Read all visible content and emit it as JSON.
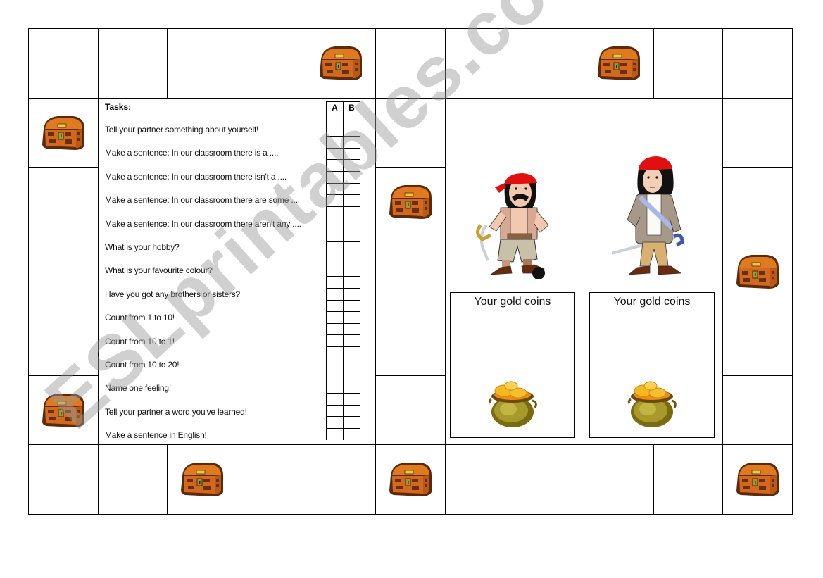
{
  "board": {
    "colors": {
      "chest_body": "#d2691e",
      "chest_lid": "#e07a1f",
      "chest_dark": "#5a2a0a",
      "lock": "#9a9a3a",
      "pot": "#8a8a1e",
      "coin": "#f5b820",
      "bandana": "#e01010"
    },
    "squares": [
      {
        "id": "top-1",
        "chest": false
      },
      {
        "id": "top-2",
        "chest": false
      },
      {
        "id": "top-3",
        "chest": false
      },
      {
        "id": "top-4",
        "chest": false
      },
      {
        "id": "top-5",
        "chest": true
      },
      {
        "id": "top-6",
        "chest": false
      },
      {
        "id": "top-7",
        "chest": false
      },
      {
        "id": "top-8",
        "chest": false
      },
      {
        "id": "top-9",
        "chest": true
      },
      {
        "id": "top-10",
        "chest": false
      },
      {
        "id": "top-11",
        "chest": false
      },
      {
        "id": "left-2",
        "chest": true
      },
      {
        "id": "left-3",
        "chest": false
      },
      {
        "id": "left-4",
        "chest": false
      },
      {
        "id": "left-5",
        "chest": false
      },
      {
        "id": "left-6",
        "chest": true
      },
      {
        "id": "mid-2",
        "chest": false
      },
      {
        "id": "mid-3",
        "chest": true
      },
      {
        "id": "mid-4",
        "chest": false
      },
      {
        "id": "mid-5",
        "chest": false
      },
      {
        "id": "mid-6",
        "chest": false
      },
      {
        "id": "right-2",
        "chest": false
      },
      {
        "id": "right-3",
        "chest": false
      },
      {
        "id": "right-4",
        "chest": true
      },
      {
        "id": "right-5",
        "chest": false
      },
      {
        "id": "right-6",
        "chest": false
      },
      {
        "id": "bottom-1",
        "chest": false
      },
      {
        "id": "bottom-2",
        "chest": false
      },
      {
        "id": "bottom-3",
        "chest": true
      },
      {
        "id": "bottom-4",
        "chest": false
      },
      {
        "id": "bottom-5",
        "chest": false
      },
      {
        "id": "bottom-6",
        "chest": true
      },
      {
        "id": "bottom-7",
        "chest": false
      },
      {
        "id": "bottom-8",
        "chest": false
      },
      {
        "id": "bottom-9",
        "chest": false
      },
      {
        "id": "bottom-10",
        "chest": false
      },
      {
        "id": "bottom-11",
        "chest": true
      }
    ]
  },
  "tasks": {
    "title": "Tasks:",
    "score_columns": [
      "A",
      "B"
    ],
    "score_rows": 28,
    "items": [
      "Tell your partner something about yourself!",
      "Make a sentence: In our classroom there is a ....",
      "Make a sentence: In our classroom there isn't a ....",
      "Make a sentence: In our classroom there are some ....",
      "Make a sentence: In our classroom there aren't any ....",
      "What is your hobby?",
      "What is your favourite colour?",
      "Have you got any brothers or sisters?",
      "Count from 1 to 10!",
      "Count from 10 to 1!",
      "Count from 10 to 20!",
      "Name one feeling!",
      "Tell your partner a word you've learned!",
      "Make a sentence in English!"
    ]
  },
  "players": [
    {
      "name": "pirate-a",
      "icon": "pirate-with-mustache",
      "coins_label": "Your gold coins",
      "coins_icon": "pot-of-gold"
    },
    {
      "name": "pirate-b",
      "icon": "pirate-young",
      "coins_label": "Your gold coins",
      "coins_icon": "pot-of-gold"
    }
  ],
  "watermark": "ESLprintables.com"
}
